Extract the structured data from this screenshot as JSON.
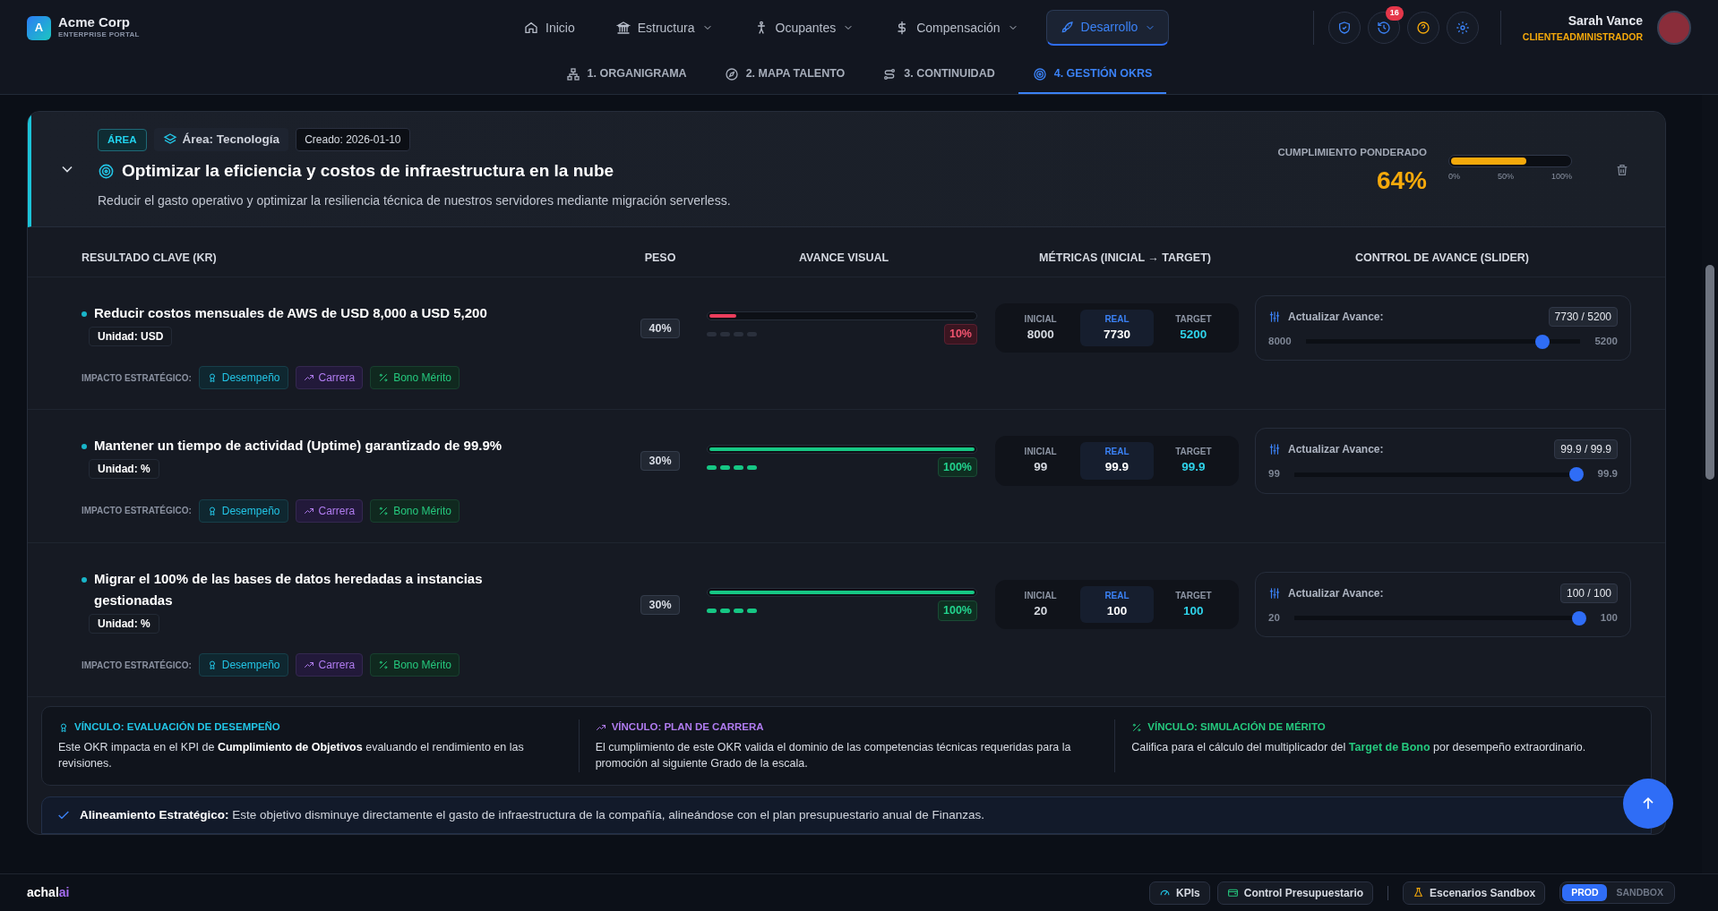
{
  "brand": {
    "logo_letter": "A",
    "name": "Acme Corp",
    "subtitle": "ENTERPRISE PORTAL"
  },
  "nav": [
    {
      "label": "Inicio",
      "dropdown": false,
      "selected": false
    },
    {
      "label": "Estructura",
      "dropdown": true,
      "selected": false
    },
    {
      "label": "Ocupantes",
      "dropdown": true,
      "selected": false
    },
    {
      "label": "Compensación",
      "dropdown": true,
      "selected": false
    },
    {
      "label": "Desarrollo",
      "dropdown": true,
      "selected": true
    }
  ],
  "notifications_badge": "16",
  "user": {
    "name": "Sarah Vance",
    "role": "CLIENTEADMINISTRADOR"
  },
  "subnav": [
    {
      "label": "1. ORGANIGRAMA",
      "selected": false
    },
    {
      "label": "2. MAPA TALENTO",
      "selected": false
    },
    {
      "label": "3. CONTINUIDAD",
      "selected": false
    },
    {
      "label": "4. GESTIÓN OKRS",
      "selected": true
    }
  ],
  "okr": {
    "expanded": true,
    "type_tag": "ÁREA",
    "area_tag": "Área: Tecnología",
    "created": "Creado: 2026-01-10",
    "title": "Optimizar la eficiencia y costos de infraestructura en la nube",
    "description": "Reducir el gasto operativo y optimizar la resiliencia técnica de nuestros servidores mediante migración serverless.",
    "compliance_label": "CUMPLIMIENTO PONDERADO",
    "compliance_value": "64%",
    "level": 0.64,
    "scale": [
      "0%",
      "50%",
      "100%"
    ]
  },
  "table": {
    "columns": [
      "RESULTADO CLAVE (KR)",
      "PESO",
      "AVANCE VISUAL",
      "MÉTRICAS (INICIAL → TARGET)",
      "CONTROL DE AVANCE (SLIDER)"
    ]
  },
  "key_results": [
    {
      "title": "Reducir costos mensuales de AWS de USD 8,000 a USD 5,200",
      "unit": "Unidad: USD",
      "weight": "40%",
      "level": 0.1,
      "percent": "10%",
      "metrics": [
        {
          "label": "INICIAL",
          "value": "8000",
          "kind": "initial"
        },
        {
          "label": "REAL",
          "value": "7730",
          "kind": "real"
        },
        {
          "label": "TARGET",
          "value": "5200",
          "kind": "target"
        }
      ],
      "slider": {
        "label": "Actualizar Avance:",
        "reading": "7730 / 5200",
        "min": "8000",
        "max": "5200",
        "level": 0.88
      },
      "impact_label": "IMPACTO ESTRATÉGICO:",
      "impacts": [
        {
          "kind": "performance",
          "label": "Desempeño"
        },
        {
          "kind": "career",
          "label": "Carrera"
        },
        {
          "kind": "merit",
          "label": "Bono Mérito"
        }
      ]
    },
    {
      "title": "Mantener un tiempo de actividad (Uptime) garantizado de 99.9%",
      "unit": "Unidad: %",
      "weight": "30%",
      "level": 1,
      "percent": "100%",
      "metrics": [
        {
          "label": "INICIAL",
          "value": "99",
          "kind": "initial"
        },
        {
          "label": "REAL",
          "value": "99.9",
          "kind": "real"
        },
        {
          "label": "TARGET",
          "value": "99.9",
          "kind": "target"
        }
      ],
      "slider": {
        "label": "Actualizar Avance:",
        "reading": "99.9 / 99.9",
        "min": "99",
        "max": "99.9",
        "level": 1
      },
      "impact_label": "IMPACTO ESTRATÉGICO:",
      "impacts": [
        {
          "kind": "performance",
          "label": "Desempeño"
        },
        {
          "kind": "career",
          "label": "Carrera"
        },
        {
          "kind": "merit",
          "label": "Bono Mérito"
        }
      ]
    },
    {
      "title": "Migrar el 100% de las bases de datos heredadas a instancias gestionadas",
      "unit": "Unidad: %",
      "weight": "30%",
      "level": 1,
      "percent": "100%",
      "metrics": [
        {
          "label": "INICIAL",
          "value": "20",
          "kind": "initial"
        },
        {
          "label": "REAL",
          "value": "100",
          "kind": "real"
        },
        {
          "label": "TARGET",
          "value": "100",
          "kind": "target"
        }
      ],
      "slider": {
        "label": "Actualizar Avance:",
        "reading": "100 / 100",
        "min": "20",
        "max": "100",
        "level": 1
      },
      "impact_label": "IMPACTO ESTRATÉGICO:",
      "impacts": [
        {
          "kind": "performance",
          "label": "Desempeño"
        },
        {
          "kind": "career",
          "label": "Carrera"
        },
        {
          "kind": "merit",
          "label": "Bono Mérito"
        }
      ]
    }
  ],
  "links": [
    {
      "kind": "performance",
      "title": "VÍNCULO: EVALUACIÓN DE DESEMPEÑO",
      "text": "Este OKR impacta en el KPI de **Cumplimiento de Objetivos** evaluando el rendimiento en las revisiones."
    },
    {
      "kind": "career",
      "title": "VÍNCULO: PLAN DE CARRERA",
      "text": "El cumplimiento de este OKR valida el dominio de las competencias técnicas requeridas para la promoción al siguiente Grado de la escala."
    },
    {
      "kind": "merit",
      "title": "VÍNCULO: SIMULACIÓN DE MÉRITO",
      "text": "Califica para el cálculo del multiplicador del **Target de Bono** por desempeño extraordinario."
    }
  ],
  "alignment": "**Alineamiento Estratégico:** Este objetivo disminuye directamente el gasto de infraestructura de la compañía, alineándose con el plan presupuestario anual de Finanzas.",
  "footer": {
    "brand": [
      {
        "text": "achal",
        "accent": false
      },
      {
        "text": "ai",
        "accent": true
      }
    ],
    "buttons": [
      "KPIs",
      "Control Presupuestario",
      "Escenarios Sandbox"
    ],
    "environments": [
      {
        "label": "PROD",
        "selected": true
      },
      {
        "label": "SANDBOX",
        "selected": false
      }
    ]
  }
}
